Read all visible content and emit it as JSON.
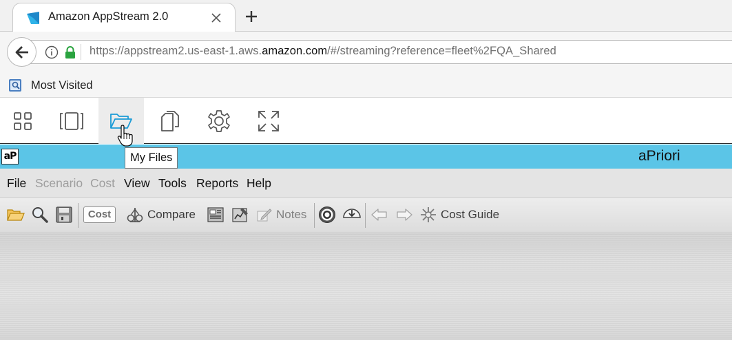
{
  "browser": {
    "tab": {
      "title": "Amazon AppStream 2.0",
      "close_icon": "close-icon"
    },
    "new_tab_label": "+",
    "url": {
      "prefix": "https://appstream2.us-east-1.aws.",
      "domain": "amazon.com",
      "suffix": "/#/streaming?reference=fleet%2FQA_Shared"
    },
    "bookmarks": [
      {
        "label": "Most Visited",
        "icon": "bookmark-folder-icon"
      }
    ]
  },
  "appstream_toolbar": {
    "buttons": [
      {
        "name": "applications",
        "icon": "grid-icon",
        "active": false
      },
      {
        "name": "windows",
        "icon": "windows-icon",
        "active": false
      },
      {
        "name": "my-files",
        "icon": "folder-open-icon",
        "active": true
      },
      {
        "name": "clipboard",
        "icon": "copy-icon",
        "active": false
      },
      {
        "name": "settings",
        "icon": "gear-icon",
        "active": false
      },
      {
        "name": "fullscreen",
        "icon": "expand-icon",
        "active": false
      }
    ],
    "tooltip": "My Files",
    "accent_color": "#1a9bd6"
  },
  "app": {
    "logo_text": "aP",
    "title": "aPriori",
    "title_bar_color": "#5bc5e7",
    "menu": [
      {
        "label": "File",
        "enabled": true
      },
      {
        "label": "Scenario",
        "enabled": false
      },
      {
        "label": "Cost",
        "enabled": false
      },
      {
        "label": "View",
        "enabled": true
      },
      {
        "label": "Tools",
        "enabled": true
      },
      {
        "label": "Reports",
        "enabled": true
      },
      {
        "label": "Help",
        "enabled": true
      }
    ],
    "toolbar": {
      "cost_label": "Cost",
      "compare_label": "Compare",
      "notes_label": "Notes",
      "cost_guide_label": "Cost Guide"
    }
  }
}
